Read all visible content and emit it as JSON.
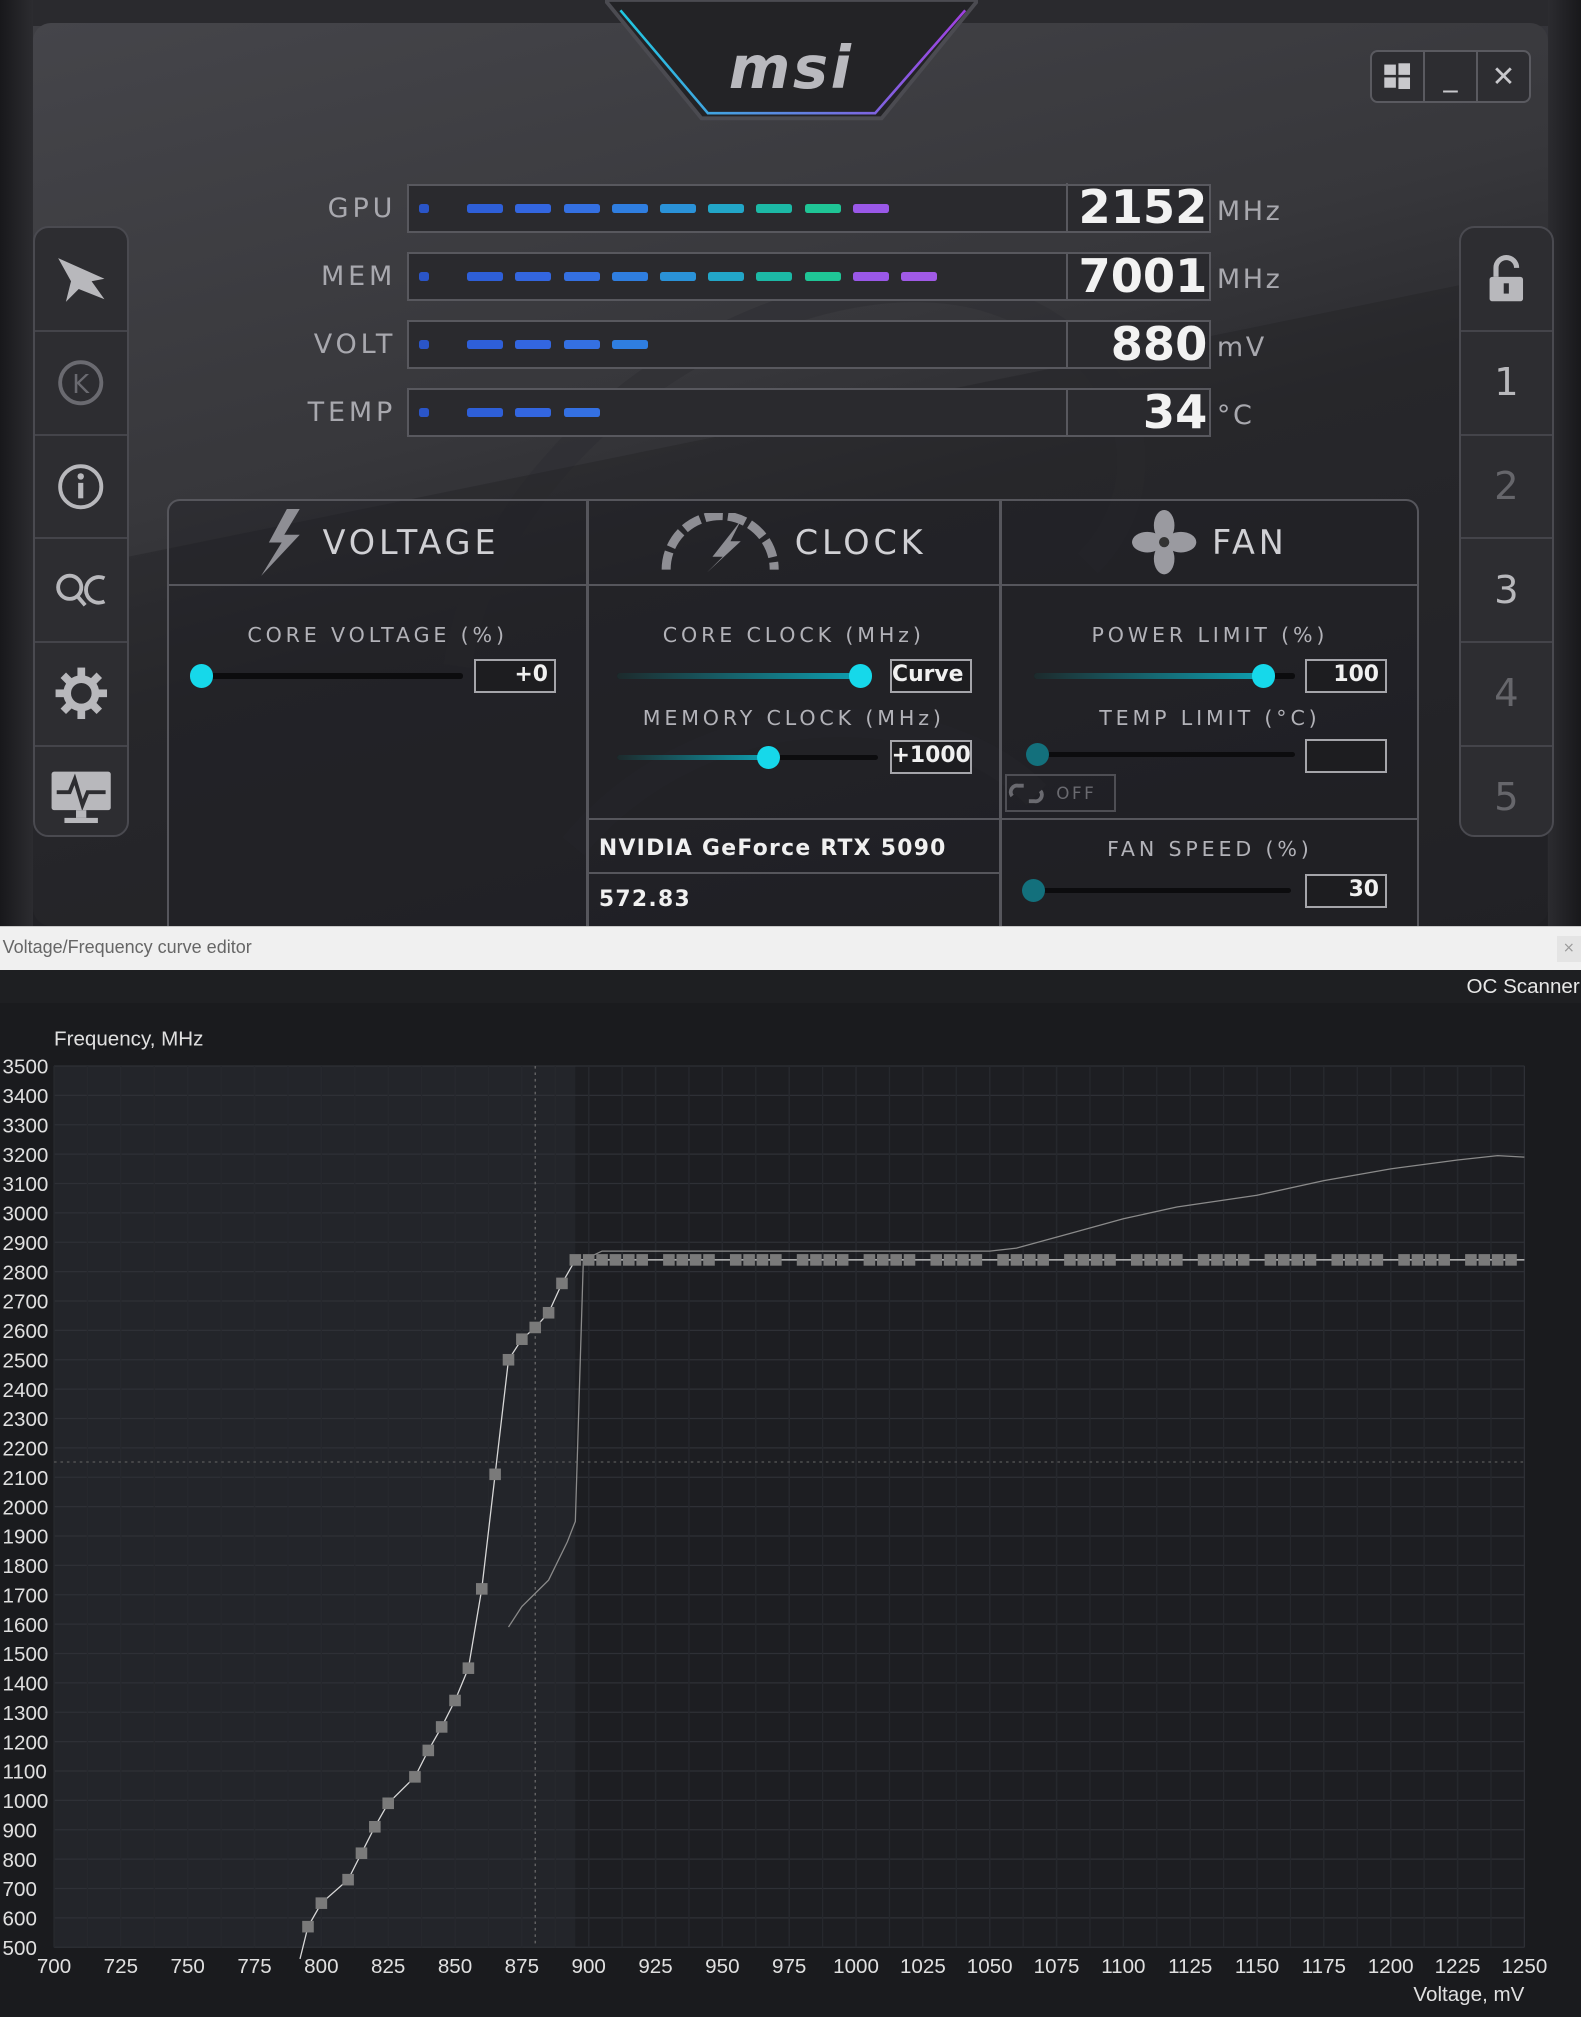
{
  "afterburner": {
    "logo": "msi",
    "window_buttons": {
      "windows": "windows",
      "minimize": "_",
      "close": "✕"
    },
    "meters": [
      {
        "label": "GPU",
        "value": "2152",
        "unit": "MHz",
        "level": 0.75
      },
      {
        "label": "MEM",
        "value": "7001",
        "unit": "MHz",
        "level": 0.82
      },
      {
        "label": "VOLT",
        "value": "880",
        "unit": "mV",
        "level": 0.4
      },
      {
        "label": "TEMP",
        "value": "34",
        "unit": "°C",
        "level": 0.32
      }
    ],
    "left_sidebar": [
      "msi-dragon-icon",
      "k-boost-icon",
      "info-icon",
      "oc-scanner-icon",
      "settings-gear-icon",
      "monitor-icon"
    ],
    "right_sidebar": {
      "lock_icon": "unlock-icon",
      "profiles": [
        "1",
        "2",
        "3",
        "4",
        "5"
      ]
    },
    "tabs": {
      "voltage": "VOLTAGE",
      "clock": "CLOCK",
      "fan": "FAN"
    },
    "controls": {
      "core_voltage": {
        "label": "CORE VOLTAGE  (%)",
        "value": "+0",
        "level": 0.0
      },
      "core_clock": {
        "label": "CORE CLOCK (MHz)",
        "value": "Curve",
        "level": 0.97
      },
      "memory_clock": {
        "label": "MEMORY CLOCK (MHz)",
        "value": "+1000",
        "level": 0.58
      },
      "power_limit": {
        "label": "POWER LIMIT (%)",
        "value": "100",
        "level": 0.88
      },
      "temp_limit": {
        "label": "TEMP LIMIT (°C)",
        "value": "",
        "level": 0.0
      },
      "link_toggle": "OFF",
      "fan_speed": {
        "label": "FAN SPEED (%)",
        "value": "30",
        "level": 0.0
      }
    },
    "gpu_name": "NVIDIA GeForce RTX 5090",
    "driver_version": "572.83"
  },
  "editor": {
    "window_title": "Voltage/Frequency curve editor",
    "close_glyph": "×",
    "oc_scanner_button": "OC Scanner",
    "y_axis_title": "Frequency, MHz",
    "x_axis_title": "Voltage, mV",
    "colors": {
      "background": "#1a1b1e",
      "plot": "#23252a",
      "curve": "#d8d8d8",
      "points": "#7a7a7a"
    }
  },
  "chart_data": {
    "type": "line",
    "xlabel": "Voltage, mV",
    "ylabel": "Frequency, MHz",
    "xlim": [
      700,
      1250
    ],
    "ylim": [
      500,
      3500
    ],
    "x_ticks": [
      700,
      725,
      750,
      775,
      800,
      825,
      850,
      875,
      900,
      925,
      950,
      975,
      1000,
      1025,
      1050,
      1075,
      1100,
      1125,
      1150,
      1175,
      1200,
      1225,
      1250
    ],
    "y_ticks": [
      500,
      600,
      700,
      800,
      900,
      1000,
      1100,
      1200,
      1300,
      1400,
      1500,
      1600,
      1700,
      1800,
      1900,
      2000,
      2100,
      2200,
      2300,
      2400,
      2500,
      2600,
      2700,
      2800,
      2900,
      3000,
      3100,
      3200,
      3300,
      3400,
      3500
    ],
    "current_voltage": 880,
    "current_frequency": 2152,
    "locked_region_start": 895,
    "series": [
      {
        "role": "edited_curve",
        "x": [
          792,
          795,
          800,
          810,
          815,
          820,
          825,
          835,
          840,
          845,
          850,
          855,
          860,
          865,
          870,
          875,
          880,
          885,
          890,
          895,
          900
        ],
        "y": [
          460,
          570,
          650,
          730,
          820,
          910,
          990,
          1080,
          1170,
          1250,
          1340,
          1450,
          1720,
          2110,
          2500,
          2570,
          2610,
          2660,
          2760,
          2840,
          2840
        ],
        "flat_to": 1250,
        "flat_value": 2840
      },
      {
        "role": "default_curve",
        "x": [
          870,
          875,
          885,
          892,
          895,
          898,
          905,
          1050,
          1060,
          1080,
          1100,
          1120,
          1150,
          1175,
          1200,
          1225,
          1240,
          1250
        ],
        "y": [
          1590,
          1660,
          1750,
          1880,
          1950,
          2840,
          2870,
          2870,
          2880,
          2930,
          2980,
          3020,
          3060,
          3110,
          3150,
          3180,
          3195,
          3190
        ]
      }
    ],
    "grid": true
  }
}
